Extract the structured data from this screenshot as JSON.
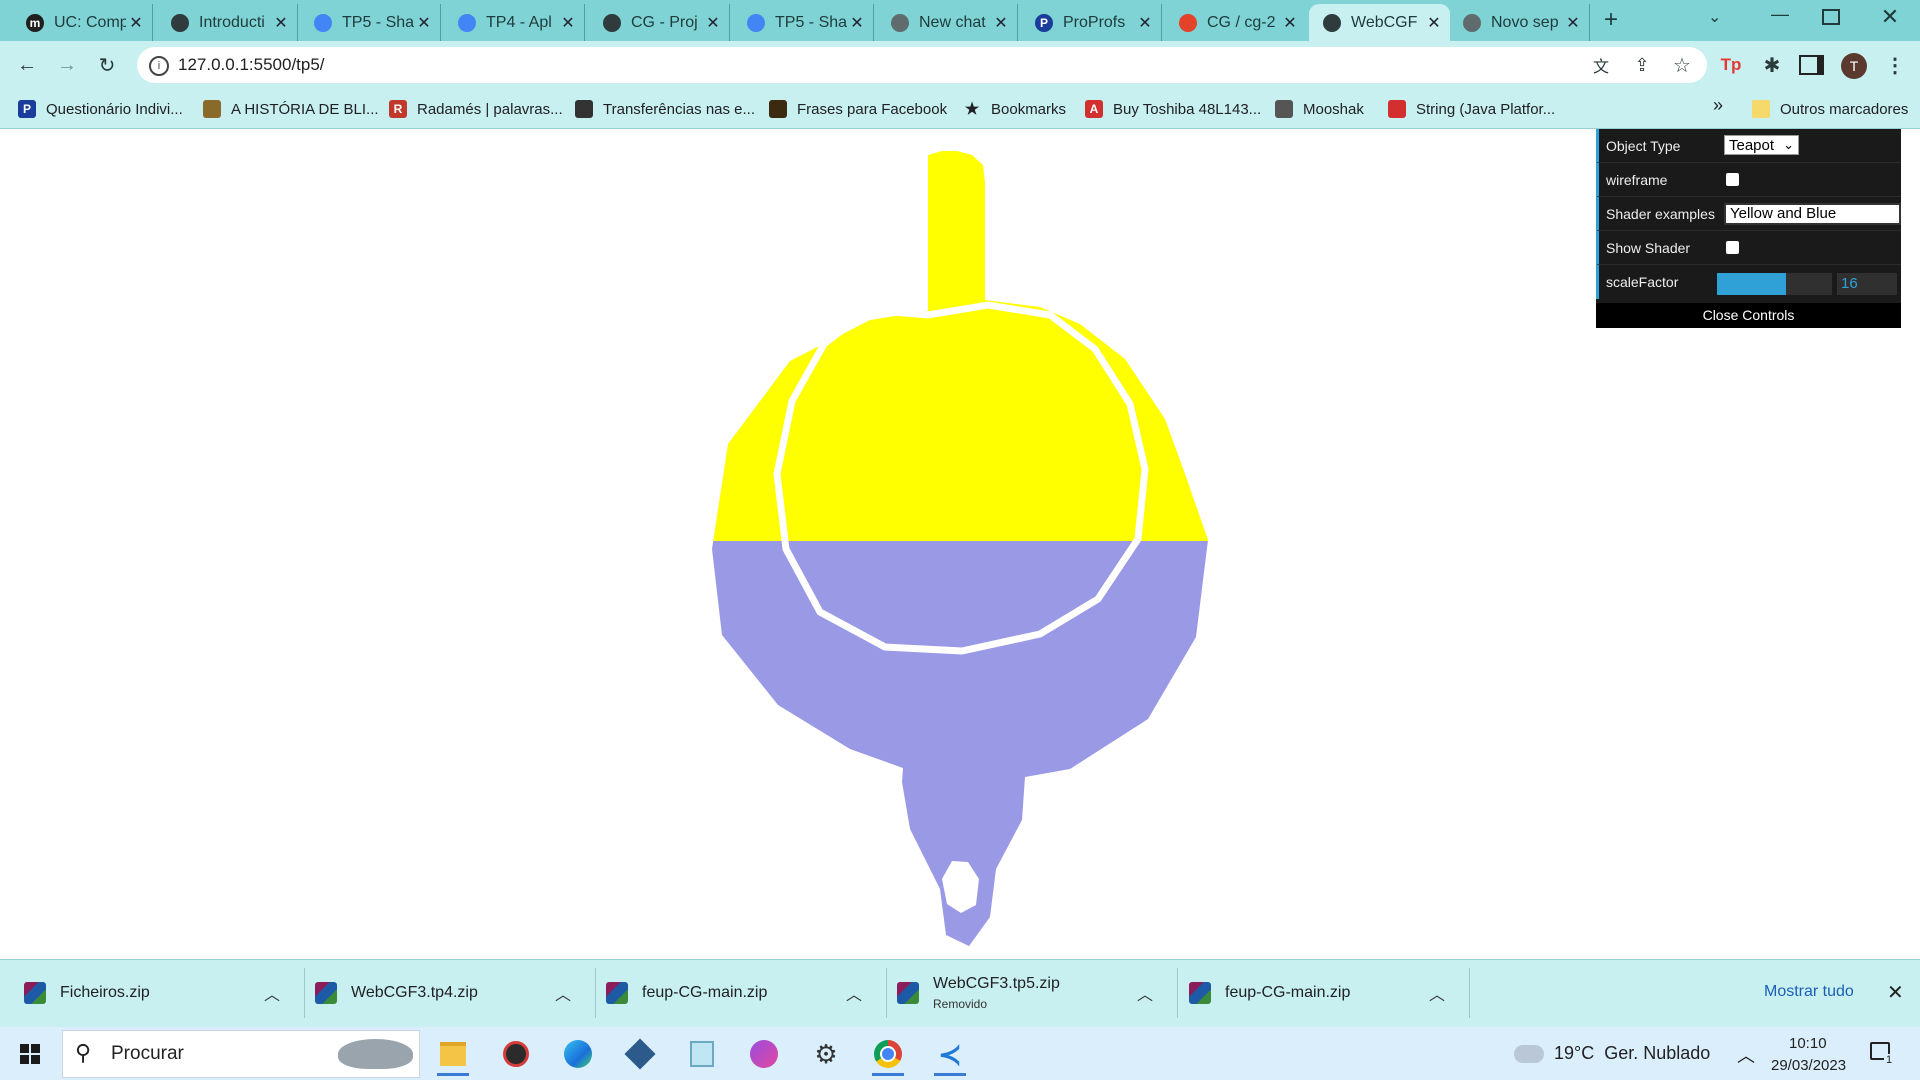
{
  "tabs": [
    {
      "label": "UC: Comp",
      "icon": "m-icon",
      "color": "#1f1f1f",
      "letter": "m"
    },
    {
      "label": "Introducti",
      "icon": "globe-icon",
      "color": "#2f3b3c",
      "letter": ""
    },
    {
      "label": "TP5 - Sha",
      "icon": "docs-icon",
      "color": "#4285f4",
      "letter": ""
    },
    {
      "label": "TP4 - Apl",
      "icon": "docs-icon",
      "color": "#4285f4",
      "letter": ""
    },
    {
      "label": "CG - Proj",
      "icon": "globe-icon",
      "color": "#2f3b3c",
      "letter": ""
    },
    {
      "label": "TP5 - Sha",
      "icon": "docs-icon",
      "color": "#4285f4",
      "letter": ""
    },
    {
      "label": "New chat",
      "icon": "openai-icon",
      "color": "#5f6b6c",
      "letter": ""
    },
    {
      "label": "ProProfs",
      "icon": "proprofs-icon",
      "color": "#1a3c9a",
      "letter": "P"
    },
    {
      "label": "CG / cg-2",
      "icon": "gitlab-icon",
      "color": "#e24329",
      "letter": ""
    },
    {
      "label": "WebCGF",
      "icon": "globe-icon",
      "color": "#2f3b3c",
      "letter": ""
    },
    {
      "label": "Novo sep",
      "icon": "chrome-icon",
      "color": "#5f6b6c",
      "letter": ""
    }
  ],
  "url": "127.0.0.1:5500/tp5/",
  "bookmarks": [
    {
      "label": "Questionário Indivi...",
      "color": "#1a3c9a",
      "letter": "P"
    },
    {
      "label": "A HISTÓRIA DE BLI...",
      "color": "#8a6a2a",
      "letter": ""
    },
    {
      "label": "Radamés | palavras...",
      "color": "#c0392b",
      "letter": "R"
    },
    {
      "label": "Transferências nas e...",
      "color": "#333333",
      "letter": ""
    },
    {
      "label": "Frases para Facebook",
      "color": "#3b2a10",
      "letter": ""
    },
    {
      "label": "Bookmarks",
      "color": "#202124",
      "letter": "★"
    },
    {
      "label": "Buy Toshiba 48L143...",
      "color": "#d32f2f",
      "letter": "A"
    },
    {
      "label": "Mooshak",
      "color": "#555555",
      "letter": ""
    },
    {
      "label": "String (Java Platfor...",
      "color": "#d32f2f",
      "letter": ""
    }
  ],
  "bookmarks_more": "»",
  "bookmarks_other": "Outros marcadores",
  "gui": {
    "object_type_label": "Object Type",
    "object_type_value": "Teapot",
    "wireframe_label": "wireframe",
    "wireframe_checked": false,
    "shader_label": "Shader examples",
    "shader_value": "Yellow and Blue",
    "show_shader_label": "Show Shader",
    "show_shader_checked": false,
    "scale_label": "scaleFactor",
    "scale_value": "16",
    "scale_fraction": 0.6,
    "close_label": "Close Controls"
  },
  "colors": {
    "yellow": "#ffff00",
    "blue": "#9999e6",
    "accent": "#2fa1d6"
  },
  "downloads": [
    {
      "name": "Ficheiros.zip",
      "status": ""
    },
    {
      "name": "WebCGF3.tp4.zip",
      "status": ""
    },
    {
      "name": "feup-CG-main.zip",
      "status": ""
    },
    {
      "name": "WebCGF3.tp5.zip",
      "status": "Removido"
    },
    {
      "name": "feup-CG-main.zip",
      "status": ""
    }
  ],
  "show_all": "Mostrar tudo",
  "taskbar": {
    "search_placeholder": "Procurar",
    "weather": "19°C  Ger. Nublado",
    "time": "10:10",
    "date": "29/03/2023",
    "notif_count": "1"
  }
}
